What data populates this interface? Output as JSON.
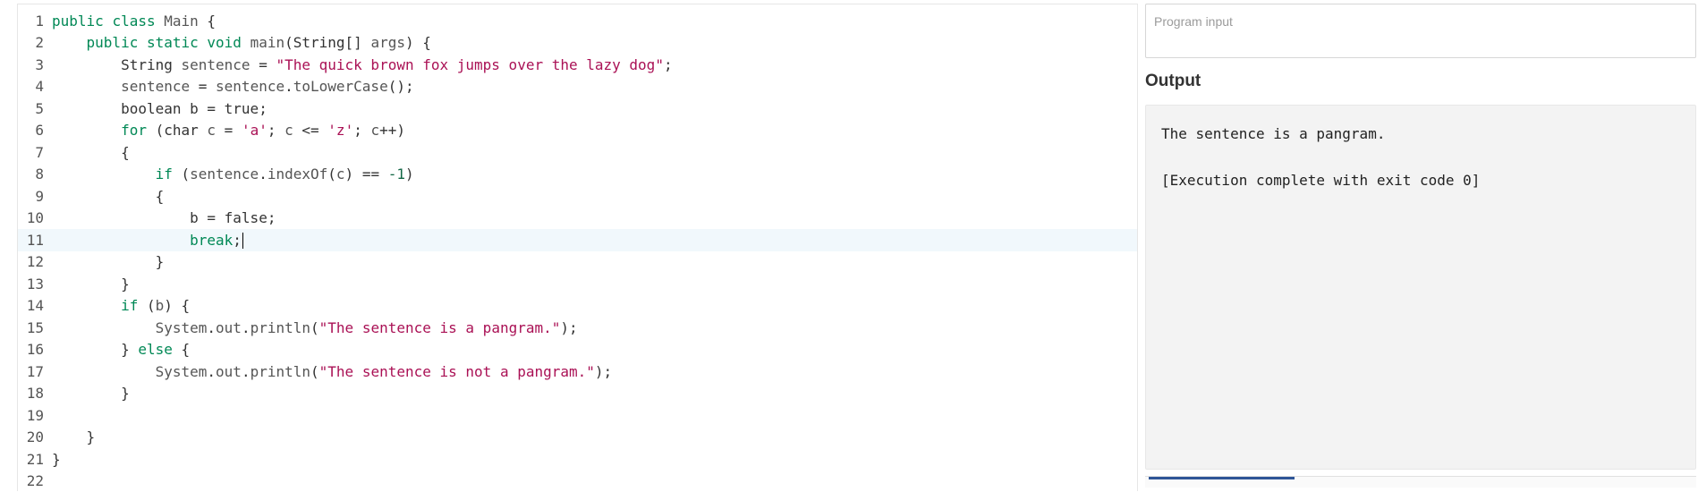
{
  "editor": {
    "lines": [
      {
        "num": "1",
        "tokens": [
          [
            "kw",
            "public"
          ],
          [
            "pl",
            " "
          ],
          [
            "kw",
            "class"
          ],
          [
            "pl",
            " "
          ],
          [
            "kw2",
            "Main"
          ],
          [
            "pl",
            " {"
          ]
        ]
      },
      {
        "num": "2",
        "tokens": [
          [
            "pl",
            "    "
          ],
          [
            "kw",
            "public"
          ],
          [
            "pl",
            " "
          ],
          [
            "kw",
            "static"
          ],
          [
            "pl",
            " "
          ],
          [
            "kw",
            "void"
          ],
          [
            "pl",
            " "
          ],
          [
            "kw2",
            "main"
          ],
          [
            "pl",
            "(String[] "
          ],
          [
            "kw2",
            "args"
          ],
          [
            "pl",
            ") {"
          ]
        ]
      },
      {
        "num": "3",
        "tokens": [
          [
            "pl",
            "        String "
          ],
          [
            "kw2",
            "sentence"
          ],
          [
            "pl",
            " = "
          ],
          [
            "str",
            "\"The quick brown fox jumps over the lazy dog\""
          ],
          [
            "pl",
            ";"
          ]
        ]
      },
      {
        "num": "4",
        "tokens": [
          [
            "pl",
            "        "
          ],
          [
            "kw2",
            "sentence"
          ],
          [
            "pl",
            " = "
          ],
          [
            "kw2",
            "sentence"
          ],
          [
            "pl",
            "."
          ],
          [
            "kw2",
            "toLowerCase"
          ],
          [
            "pl",
            "();"
          ]
        ]
      },
      {
        "num": "5",
        "tokens": [
          [
            "pl",
            "        "
          ],
          [
            "pl",
            "boolean b = "
          ],
          [
            "pl",
            "true;"
          ]
        ]
      },
      {
        "num": "6",
        "tokens": [
          [
            "pl",
            "        "
          ],
          [
            "kw",
            "for"
          ],
          [
            "pl",
            " ("
          ],
          [
            "pl",
            "char "
          ],
          [
            "kw2",
            "c"
          ],
          [
            "pl",
            " = "
          ],
          [
            "str",
            "'a'"
          ],
          [
            "pl",
            "; "
          ],
          [
            "kw2",
            "c"
          ],
          [
            "pl",
            " <= "
          ],
          [
            "str",
            "'z'"
          ],
          [
            "pl",
            "; "
          ],
          [
            "kw2",
            "c"
          ],
          [
            "pl",
            "++)"
          ]
        ]
      },
      {
        "num": "7",
        "tokens": [
          [
            "pl",
            "        {"
          ]
        ]
      },
      {
        "num": "8",
        "tokens": [
          [
            "pl",
            "            "
          ],
          [
            "kw",
            "if"
          ],
          [
            "pl",
            " ("
          ],
          [
            "kw2",
            "sentence"
          ],
          [
            "pl",
            "."
          ],
          [
            "kw2",
            "indexOf"
          ],
          [
            "pl",
            "("
          ],
          [
            "kw2",
            "c"
          ],
          [
            "pl",
            ") == "
          ],
          [
            "num",
            "-1"
          ],
          [
            "pl",
            ")"
          ]
        ]
      },
      {
        "num": "9",
        "tokens": [
          [
            "pl",
            "            {"
          ]
        ]
      },
      {
        "num": "10",
        "tokens": [
          [
            "pl",
            "                b = "
          ],
          [
            "pl",
            "false;"
          ]
        ]
      },
      {
        "num": "11",
        "tokens": [
          [
            "pl",
            "                "
          ],
          [
            "kw",
            "break"
          ],
          [
            "pl",
            ";"
          ]
        ],
        "active": true,
        "cursor": true
      },
      {
        "num": "12",
        "tokens": [
          [
            "pl",
            "            }"
          ]
        ]
      },
      {
        "num": "13",
        "tokens": [
          [
            "pl",
            "        }"
          ]
        ]
      },
      {
        "num": "14",
        "tokens": [
          [
            "pl",
            "        "
          ],
          [
            "kw",
            "if"
          ],
          [
            "pl",
            " ("
          ],
          [
            "kw2",
            "b"
          ],
          [
            "pl",
            ") {"
          ]
        ]
      },
      {
        "num": "15",
        "tokens": [
          [
            "pl",
            "            "
          ],
          [
            "kw2",
            "System"
          ],
          [
            "pl",
            "."
          ],
          [
            "kw2",
            "out"
          ],
          [
            "pl",
            "."
          ],
          [
            "kw2",
            "println"
          ],
          [
            "pl",
            "("
          ],
          [
            "str",
            "\"The sentence is a pangram.\""
          ],
          [
            "pl",
            ");"
          ]
        ]
      },
      {
        "num": "16",
        "tokens": [
          [
            "pl",
            "        } "
          ],
          [
            "kw",
            "else"
          ],
          [
            "pl",
            " {"
          ]
        ]
      },
      {
        "num": "17",
        "tokens": [
          [
            "pl",
            "            "
          ],
          [
            "kw2",
            "System"
          ],
          [
            "pl",
            "."
          ],
          [
            "kw2",
            "out"
          ],
          [
            "pl",
            "."
          ],
          [
            "kw2",
            "println"
          ],
          [
            "pl",
            "("
          ],
          [
            "str",
            "\"The sentence is not a pangram.\""
          ],
          [
            "pl",
            ");"
          ]
        ]
      },
      {
        "num": "18",
        "tokens": [
          [
            "pl",
            "        }"
          ]
        ]
      },
      {
        "num": "19",
        "tokens": [
          [
            "pl",
            ""
          ]
        ]
      },
      {
        "num": "20",
        "tokens": [
          [
            "pl",
            "    }"
          ]
        ]
      },
      {
        "num": "21",
        "tokens": [
          [
            "pl",
            "}"
          ]
        ]
      },
      {
        "num": "22",
        "tokens": [
          [
            "pl",
            ""
          ]
        ]
      }
    ]
  },
  "input": {
    "placeholder": "Program input",
    "value": ""
  },
  "output": {
    "heading": "Output",
    "text": "The sentence is a pangram.\n\n[Execution complete with exit code 0]"
  }
}
